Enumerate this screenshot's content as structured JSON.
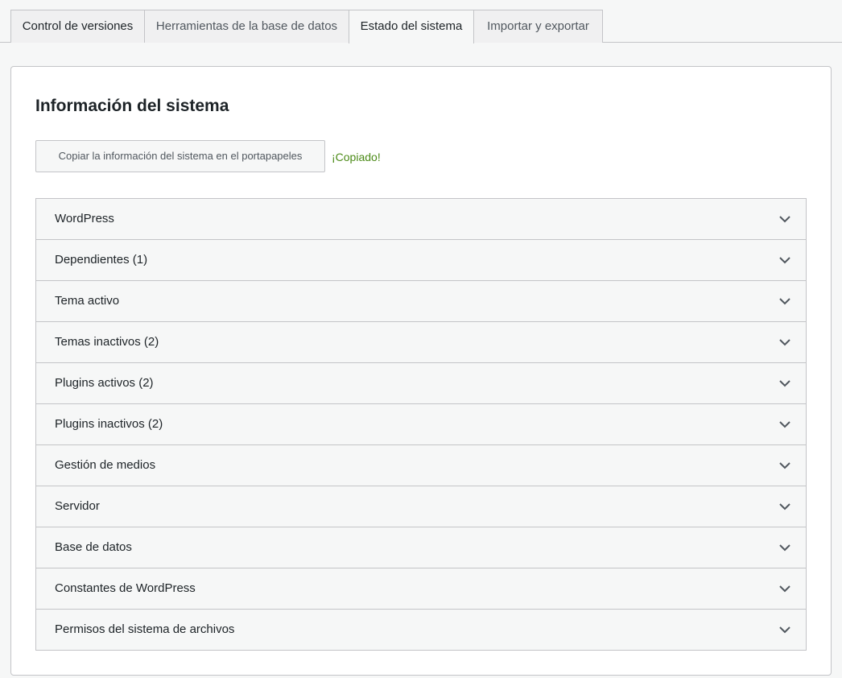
{
  "tabs": [
    {
      "label": "Control de versiones",
      "active": false
    },
    {
      "label": "Herramientas de la base de datos",
      "active": false
    },
    {
      "label": "Estado del sistema",
      "active": true
    },
    {
      "label": "Importar y exportar",
      "active": false
    }
  ],
  "panel": {
    "title": "Información del sistema",
    "copy_button_label": "Copiar la información del sistema en el portapapeles",
    "copied_notice": "¡Copiado!",
    "sections": [
      {
        "label": "WordPress"
      },
      {
        "label": "Dependientes (1)"
      },
      {
        "label": "Tema activo"
      },
      {
        "label": "Temas inactivos (2)"
      },
      {
        "label": "Plugins activos (2)"
      },
      {
        "label": "Plugins inactivos (2)"
      },
      {
        "label": "Gestión de medios"
      },
      {
        "label": "Servidor"
      },
      {
        "label": "Base de datos"
      },
      {
        "label": "Constantes de WordPress"
      },
      {
        "label": "Permisos del sistema de archivos"
      }
    ]
  },
  "colors": {
    "background": "#f6f7f7",
    "panel": "#ffffff",
    "border": "#c3c4c7",
    "success_text": "#4b8a17"
  },
  "icons": {
    "section_toggle": "chevron-down-icon"
  }
}
